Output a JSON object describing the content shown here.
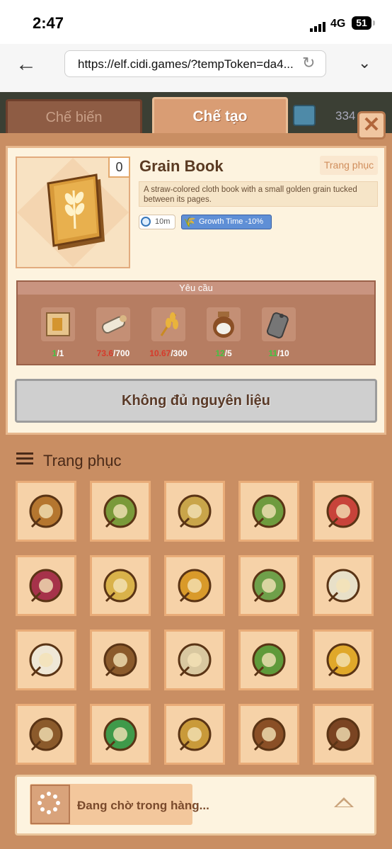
{
  "status_bar": {
    "time": "2:47",
    "network": "4G",
    "battery": "51"
  },
  "browser": {
    "url": "https://elf.cidi.games/?tempToken=da4..."
  },
  "tabs": [
    {
      "label": "Chế biến",
      "active": false
    },
    {
      "label": "Chế tạo",
      "active": true
    }
  ],
  "currency": {
    "amount": "334"
  },
  "item": {
    "quantity": "0",
    "name": "Grain Book",
    "category": "Trang phục",
    "description": "A straw-colored cloth book with a small golden grain tucked between its pages.",
    "craft_time": "10m",
    "bonus": "Growth Time -10%"
  },
  "requirements": {
    "title": "Yêu cầu",
    "items": [
      {
        "icon": "grain-book-page-icon",
        "have": "1",
        "need": "/1",
        "enough": true
      },
      {
        "icon": "birch-log-icon",
        "have": "73.6",
        "need": "/700",
        "enough": false
      },
      {
        "icon": "wheat-icon",
        "have": "10.67",
        "need": "/300",
        "enough": false
      },
      {
        "icon": "flour-jar-icon",
        "have": "12",
        "need": "/5",
        "enough": true
      },
      {
        "icon": "iron-tag-icon",
        "have": "11",
        "need": "/10",
        "enough": true
      }
    ]
  },
  "craft_button": {
    "label": "Không đủ nguyên liệu"
  },
  "list": {
    "title": "Trang phục",
    "items": [
      "flower-hairpin-icon",
      "bronze-brooch-icon",
      "leaf-hairclip-icon",
      "artichoke-pin-icon",
      "berry-bracelet-icon",
      "ruby-brooch-icon",
      "wheat-hairpin-icon",
      "amber-earring-icon",
      "blossom-pin-icon",
      "flower-wreath-icon",
      "white-rose-pin-icon",
      "wooden-shield-brooch-icon",
      "rosebud-hairpin-icon",
      "green-gem-brooch-icon",
      "sun-earring-icon",
      "seed-pendant-icon",
      "heart-leaf-pendant-icon",
      "clover-locket-icon",
      "root-book-icon",
      "sprout-book-icon"
    ]
  },
  "queue": {
    "label": "Đang chờ trong hàng..."
  },
  "colors": {
    "accent": "#d99d74",
    "panel": "#fdf3df",
    "bad": "#d63b2b",
    "ok": "#47c142",
    "bonus": "#5f8fd6"
  }
}
